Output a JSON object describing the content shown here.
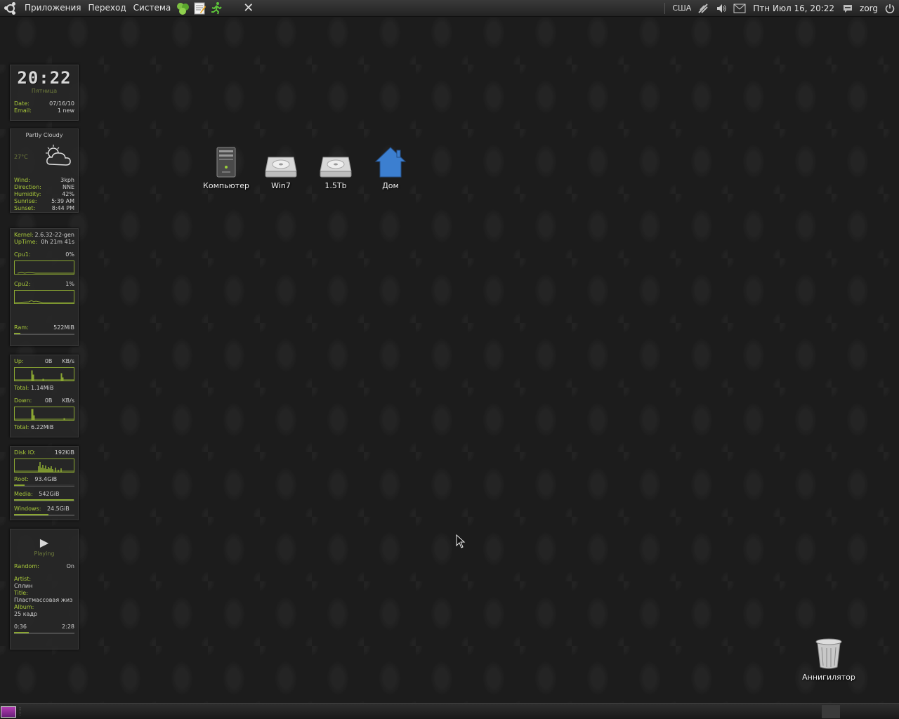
{
  "top_panel": {
    "menus": [
      "Приложения",
      "Переход",
      "Система"
    ],
    "layout": "США",
    "clock": "Птн Июл 16, 20:22",
    "user": "zorg"
  },
  "clock_widget": {
    "time": "20:22",
    "day": "Пятница",
    "date_label": "Date:",
    "date_value": "07/16/10",
    "email_label": "Email:",
    "email_value": "1 new"
  },
  "weather_widget": {
    "condition": "Partly Cloudy",
    "temp": "27°C",
    "rows": [
      {
        "label": "Wind:",
        "value": "3kph"
      },
      {
        "label": "Direction:",
        "value": "NNE"
      },
      {
        "label": "Humidity:",
        "value": "42%"
      },
      {
        "label": "Sunrise:",
        "value": "5:39 AM"
      },
      {
        "label": "Sunset:",
        "value": "8:44 PM"
      }
    ]
  },
  "system_widget": {
    "kernel_label": "Kernel:",
    "kernel_value": "2.6.32-22-gen",
    "uptime_label": "UpTime:",
    "uptime_value": "0h 21m 41s",
    "cpu1_label": "Cpu1:",
    "cpu1_value": "0%",
    "cpu2_label": "Cpu2:",
    "cpu2_value": "1%",
    "ram_label": "Ram:",
    "ram_value": "522MiB",
    "ram_fill": 0.1
  },
  "network_widget": {
    "up_label": "Up:",
    "up_value": "0B",
    "up_unit": "KB/s",
    "up_total_label": "Total:",
    "up_total_value": "1.14MiB",
    "down_label": "Down:",
    "down_value": "0B",
    "down_unit": "KB/s",
    "down_total_label": "Total:",
    "down_total_value": "6.22MiB"
  },
  "disk_widget": {
    "io_label": "Disk IO:",
    "io_value": "192KiB",
    "root_label": "Root:",
    "root_value": "93.4GiB",
    "root_fill": 0.17,
    "media_label": "Media:",
    "media_value": "542GiB",
    "media_fill": 0.99,
    "windows_label": "Windows:",
    "windows_value": "24.5GiB",
    "windows_fill": 0.57
  },
  "player_widget": {
    "state": "Playing",
    "random_label": "Random:",
    "random_value": "On",
    "artist_label": "Artist:",
    "artist_value": "Сплин",
    "title_label": "Title:",
    "title_value": "Пластмассовая жиз",
    "album_label": "Album:",
    "album_value": "25 кадр",
    "elapsed": "0:36",
    "total": "2:28",
    "progress": 0.24
  },
  "desktop_icons": [
    {
      "label": "Компьютер",
      "icon": "computer-icon"
    },
    {
      "label": "Win7",
      "icon": "hard-drive-icon"
    },
    {
      "label": "1.5Tb",
      "icon": "hard-drive-icon"
    },
    {
      "label": "Дом",
      "icon": "home-folder-icon"
    },
    {
      "label": "Аннигилятор",
      "icon": "trash-icon"
    }
  ],
  "colors": {
    "accent": "#8aa632",
    "panel": "#2b2b2b",
    "home_icon": "#3c7fd0"
  }
}
